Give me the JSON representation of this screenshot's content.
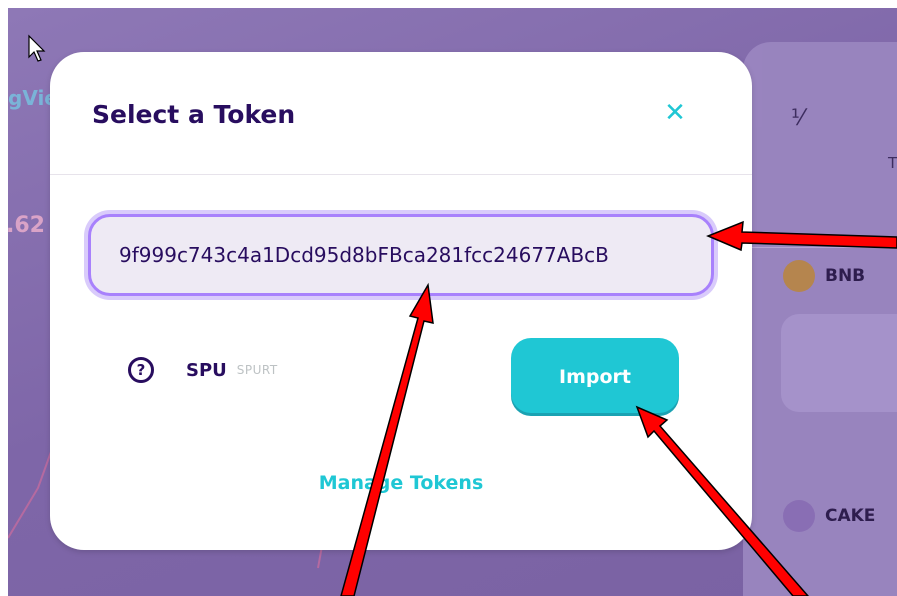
{
  "background": {
    "chart_label": "gVie",
    "chart_percent": ".62",
    "tokens": [
      {
        "symbol": "BNB",
        "color": "#b8874a"
      },
      {
        "symbol": "CAKE",
        "color": "#8a6fb5"
      }
    ],
    "column_letter": "T"
  },
  "modal": {
    "title": "Select a Token",
    "close_icon": "close-icon",
    "search": {
      "value": "9f999c743c4a1Dcd95d8bFBca281fcc24677ABcB",
      "placeholder": ""
    },
    "token": {
      "symbol": "SPU",
      "name": "SPURT"
    },
    "import_label": "Import",
    "manage_label": "Manage Tokens"
  },
  "colors": {
    "accent": "#1fc7d4",
    "text": "#280d5f",
    "input_border": "#a881fc",
    "annotation_arrow": "#ff0000"
  }
}
